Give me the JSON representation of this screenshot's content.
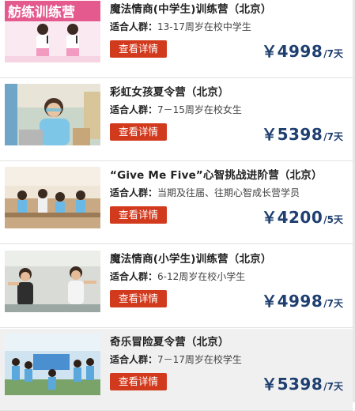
{
  "items": [
    {
      "title": "魔法情商(中学生)训练营（北京）",
      "audience_label": "适合人群：",
      "audience_value": "13-17周岁在校中学生",
      "button_label": "查看详情",
      "price_currency": "￥",
      "price_amount": "4998",
      "price_unit": "/7天",
      "photo_caption": "舫练训练营"
    },
    {
      "title": "彩虹女孩夏令营（北京）",
      "audience_label": "适合人群：",
      "audience_value": "7－15周岁在校女生",
      "button_label": "查看详情",
      "price_currency": "￥",
      "price_amount": "5398",
      "price_unit": "/7天"
    },
    {
      "title": "“Give Me Five”心智挑战进阶营（北京）",
      "audience_label": "适合人群：",
      "audience_value": "当期及往届、往期心智成长营学员",
      "button_label": "查看详情",
      "price_currency": "￥",
      "price_amount": "4200",
      "price_unit": "/5天"
    },
    {
      "title": "魔法情商(小学生)训练营（北京）",
      "audience_label": "适合人群：",
      "audience_value": "6-12周岁在校小学生",
      "button_label": "查看详情",
      "price_currency": "￥",
      "price_amount": "4998",
      "price_unit": "/7天"
    },
    {
      "title": "奇乐冒险夏令营（北京）",
      "audience_label": "适合人群：",
      "audience_value": "7－17周岁在校学生",
      "button_label": "查看详情",
      "price_currency": "￥",
      "price_amount": "5398",
      "price_unit": "/7天"
    }
  ],
  "colors": {
    "button_bg": "#d23a1e",
    "price": "#1e3f70",
    "alt_row_bg": "#f0f0f0"
  }
}
